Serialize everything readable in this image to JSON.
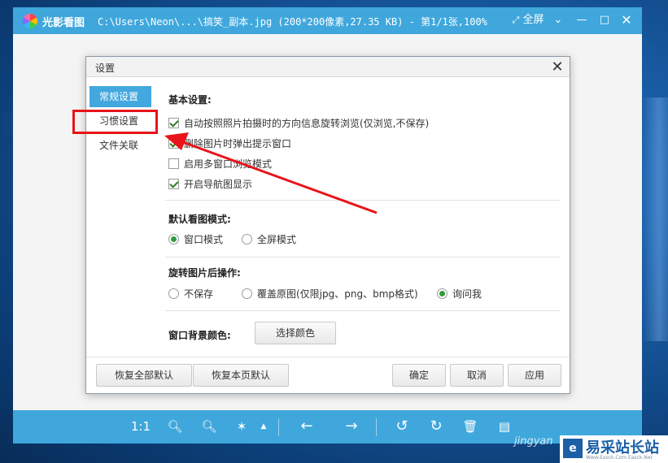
{
  "app": {
    "name": "光影看图",
    "file_info": "C:\\Users\\Neon\\...\\搞笑_副本.jpg (200*200像素,27.35 KB) - 第1/1张,100%",
    "fullscreen_label": "全屏",
    "accent_color": "#3fa7dc"
  },
  "dialog": {
    "title": "设置",
    "nav": [
      {
        "label": "常规设置",
        "active": true
      },
      {
        "label": "习惯设置",
        "active": false
      },
      {
        "label": "文件关联",
        "active": false
      }
    ],
    "basic": {
      "title": "基本设置:",
      "options": [
        {
          "label": "自动按照照片拍摄时的方向信息旋转浏览(仅浏览,不保存)",
          "checked": true
        },
        {
          "label": "删除图片时弹出提示窗口",
          "checked": true
        },
        {
          "label": "启用多窗口浏览模式",
          "checked": false
        },
        {
          "label": "开启导航图显示",
          "checked": true
        }
      ]
    },
    "view_mode": {
      "title": "默认看图模式:",
      "options": [
        {
          "label": "窗口模式",
          "checked": true
        },
        {
          "label": "全屏模式",
          "checked": false
        }
      ]
    },
    "rotate": {
      "title": "旋转图片后操作:",
      "options": [
        {
          "label": "不保存",
          "checked": false
        },
        {
          "label": "覆盖原图(仅限jpg、png、bmp格式)",
          "checked": false
        },
        {
          "label": "询问我",
          "checked": true
        }
      ]
    },
    "bg_color": {
      "title": "窗口背景颜色:",
      "button": "选择颜色"
    },
    "buttons": {
      "restore_all": "恢复全部默认",
      "restore_page": "恢复本页默认",
      "ok": "确定",
      "cancel": "取消",
      "apply": "应用"
    }
  },
  "toolbar": {
    "ratio_label": "1:1"
  },
  "watermark": {
    "site": "易采站长站",
    "sub": "Www.Easck.Com Easck.Net",
    "jingyan": "jingyan"
  },
  "annotation_color": "#e8141a"
}
